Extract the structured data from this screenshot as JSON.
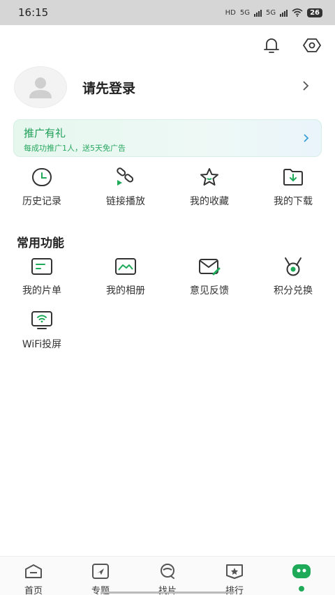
{
  "status_bar": {
    "time": "16:15",
    "network_1": "5G",
    "network_2": "5G",
    "hd_label": "HD",
    "battery": "26"
  },
  "header": {
    "icons": [
      "bell-icon",
      "settings-icon"
    ]
  },
  "profile": {
    "login_text": "请先登录"
  },
  "promo": {
    "title": "推广有礼",
    "subtitle": "每成功推广1人，送5天免广告"
  },
  "quick_actions": [
    {
      "label": "历史记录",
      "icon": "clock-icon"
    },
    {
      "label": "链接播放",
      "icon": "link-play-icon"
    },
    {
      "label": "我的收藏",
      "icon": "star-icon"
    },
    {
      "label": "我的下载",
      "icon": "download-folder-icon"
    }
  ],
  "common_section": {
    "title": "常用功能",
    "items": [
      {
        "label": "我的片单",
        "icon": "playlist-icon"
      },
      {
        "label": "我的相册",
        "icon": "album-icon"
      },
      {
        "label": "意见反馈",
        "icon": "feedback-mail-icon"
      },
      {
        "label": "积分兑换",
        "icon": "medal-icon"
      },
      {
        "label": "WiFi投屏",
        "icon": "wifi-cast-icon"
      }
    ]
  },
  "bottom_nav": [
    {
      "label": "首页",
      "icon": "home-icon"
    },
    {
      "label": "专题",
      "icon": "topic-icon"
    },
    {
      "label": "找片",
      "icon": "search-film-icon"
    },
    {
      "label": "排行",
      "icon": "rank-icon"
    },
    {
      "label": "",
      "icon": "profile-tab-icon",
      "active": true
    }
  ],
  "colors": {
    "accent": "#1faa59",
    "promo_text": "#1b9d55",
    "icon_stroke": "#333333"
  }
}
